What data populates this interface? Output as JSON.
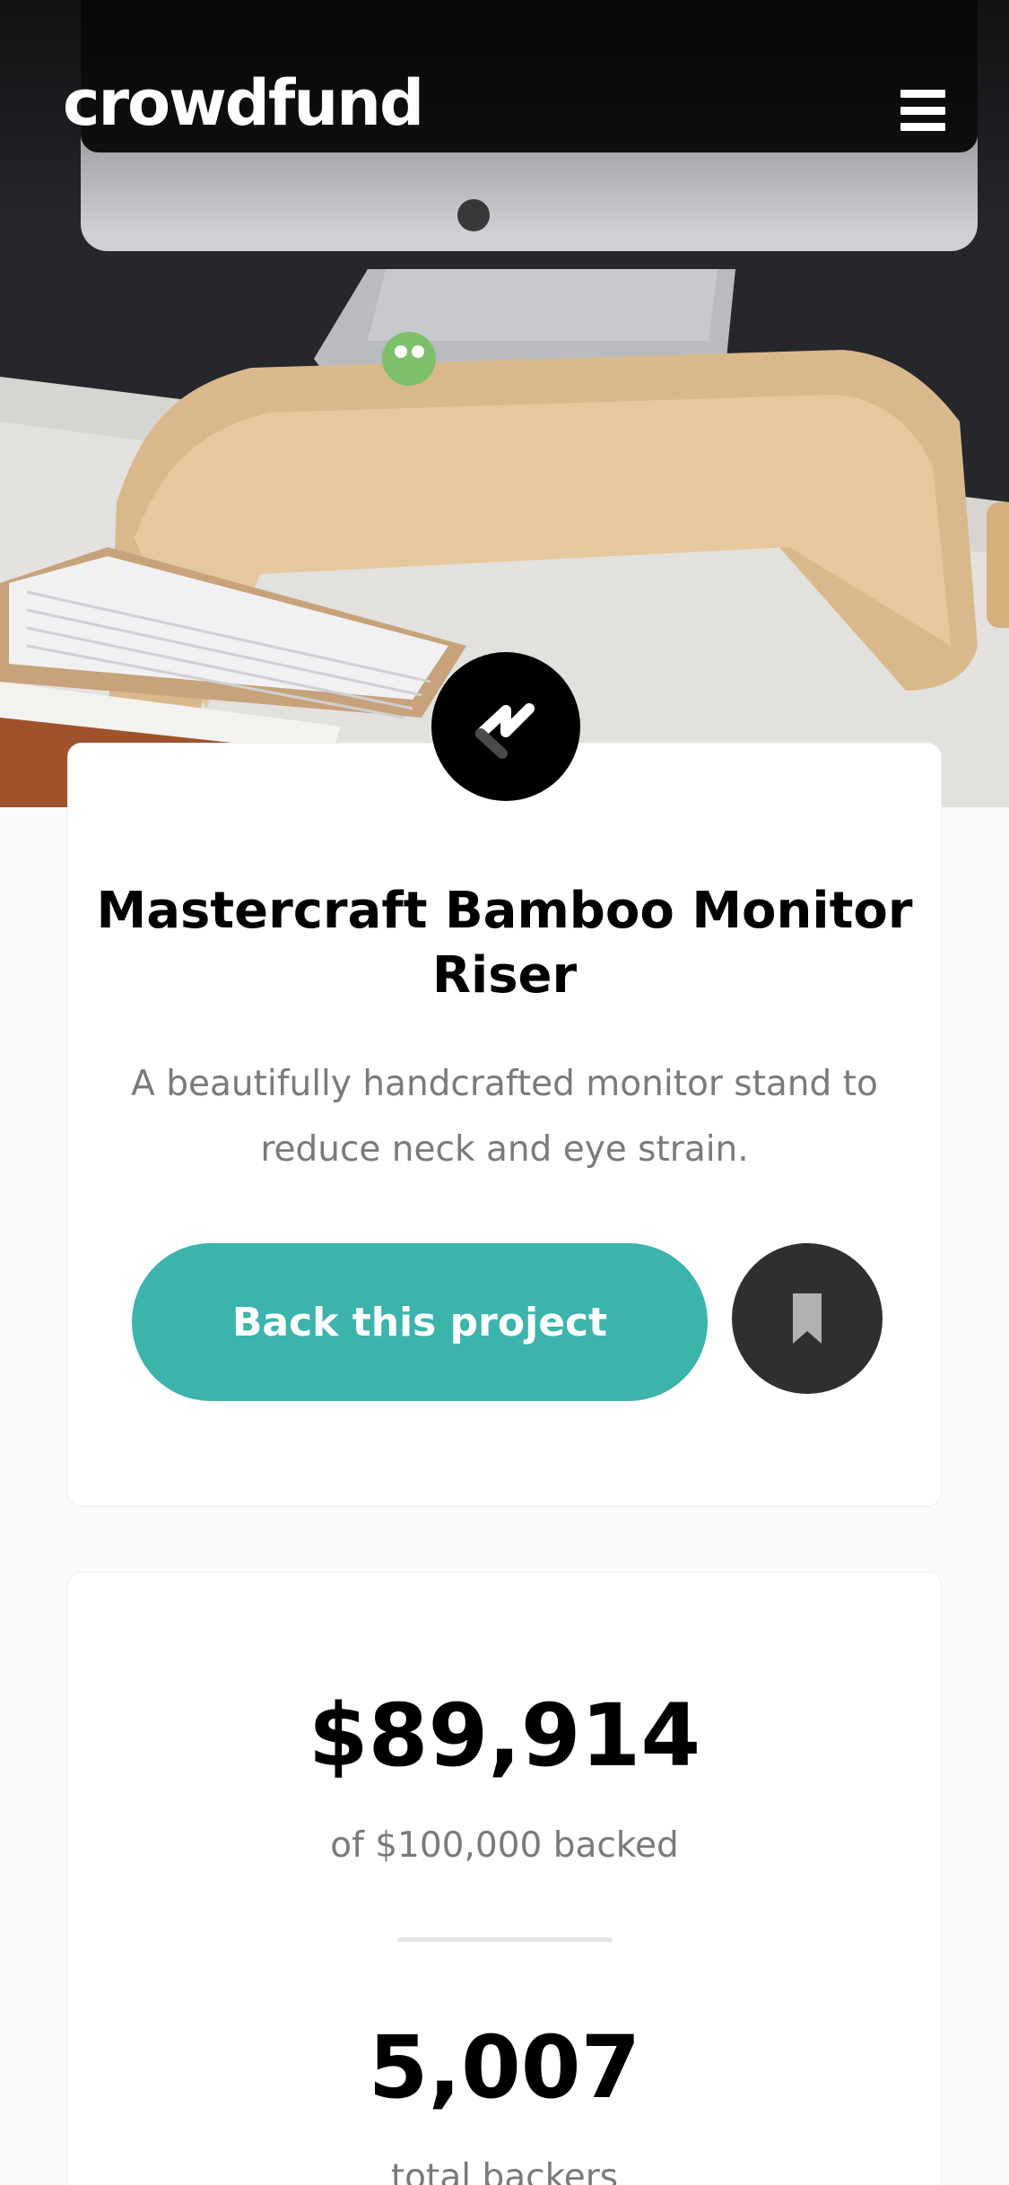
{
  "header": {
    "logo_text": "crowdfund",
    "menu_icon": "hamburger-icon"
  },
  "hero": {
    "image_description_icon": "desk-monitor-photo"
  },
  "project": {
    "brand_icon": "mastercraft-logo-icon",
    "title": "Mastercraft Bamboo Monitor Riser",
    "description": "A beautifully handcrafted monitor stand to reduce neck and eye strain.",
    "back_button_label": "Back this project",
    "bookmark_icon": "bookmark-icon"
  },
  "stats": {
    "amount_backed": "$89,914",
    "amount_label": "of $100,000 backed",
    "total_backers": "5,007",
    "backers_label": "total backers"
  },
  "colors": {
    "accent": "#3cb3ab",
    "dark": "#2f2f2f",
    "background": "#fafafa",
    "text_muted": "#7a7a7a"
  }
}
